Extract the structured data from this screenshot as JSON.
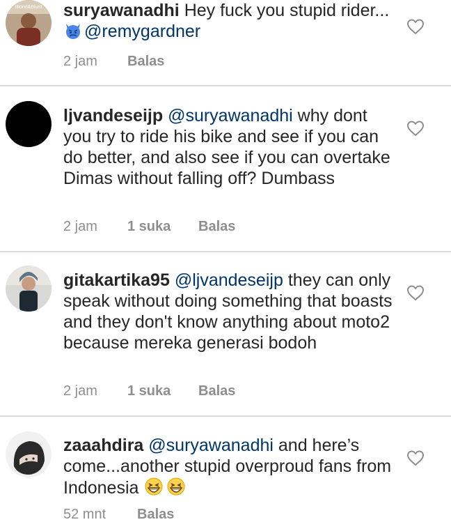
{
  "comments": [
    {
      "username": "suryawanadhi",
      "mention": "",
      "text": "Hey fuck you stupid rider...",
      "line2_mention": "@remygardner",
      "time": "2 jam",
      "likes": "",
      "reply": "Balas",
      "avatar_text": "Blond&Blunt"
    },
    {
      "username": "ljvandeseijp",
      "mention": "@suryawanadhi",
      "text": "why dont you try to ride his bike and see if you can do better, and also see if you can overtake Dimas without falling off? Dumbass",
      "time": "2 jam",
      "likes": "1 suka",
      "reply": "Balas"
    },
    {
      "username": "gitakartika95",
      "mention": "@ljvandeseijp",
      "text": "they can only speak without doing something that boasts and they don't know anything about moto2 because mereka generasi bodoh",
      "time": "2 jam",
      "likes": "1 suka",
      "reply": "Balas"
    },
    {
      "username": "zaaahdira",
      "mention": "@suryawanadhi",
      "text": "and here’s come...another stupid overproud fans from Indonesia",
      "time": "52 mnt",
      "likes": "",
      "reply": "Balas"
    }
  ],
  "icons": {
    "like": "heart-outline-icon",
    "emoji_devil": "angry-devil-emoji",
    "emoji_grin": "grinning-squinting-face-emoji"
  },
  "colors": {
    "text": "#262626",
    "meta": "#8e8e8e",
    "mention": "#003569",
    "divider": "#dbdbdb"
  }
}
